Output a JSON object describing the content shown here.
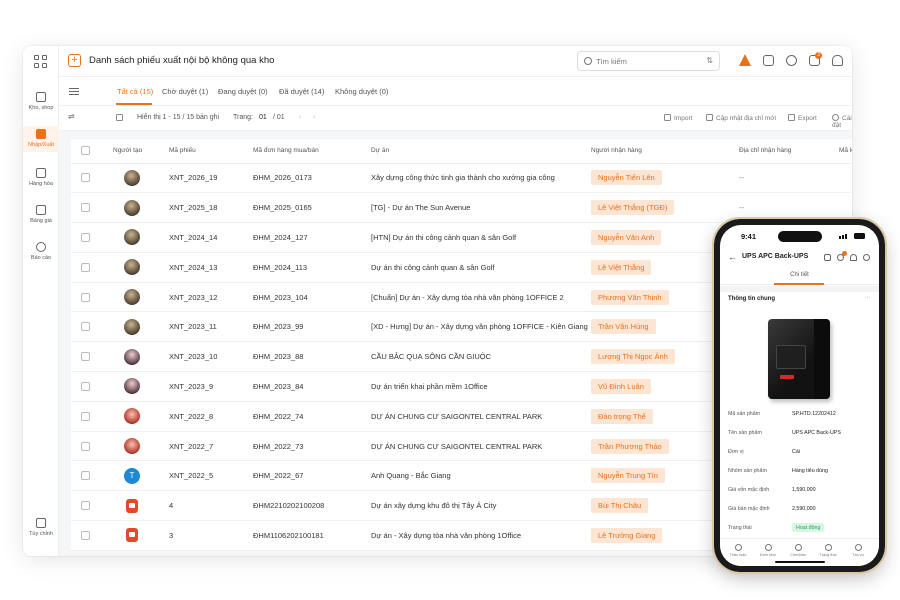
{
  "sidebar": {
    "items": [
      {
        "label": "Kho, shop"
      },
      {
        "label": "Nhập/Xuất"
      },
      {
        "label": "Hàng hóa"
      },
      {
        "label": "Bảng giá"
      },
      {
        "label": "Báo cáo"
      }
    ],
    "bottom": {
      "label": "Tùy chỉnh"
    }
  },
  "header": {
    "title": "Danh sách phiếu xuất nội bộ không qua kho",
    "search_placeholder": "Tìm kiếm",
    "notification_count": "3"
  },
  "tabs": [
    {
      "label": "Tất cả (15)"
    },
    {
      "label": "Chờ duyệt (1)"
    },
    {
      "label": "Đang duyệt (0)"
    },
    {
      "label": "Đã duyệt (14)"
    },
    {
      "label": "Không duyệt (0)"
    }
  ],
  "toolbar": {
    "summary": "Hiển thị 1 - 15 / 15 bản ghi",
    "page_label": "Trang:",
    "page_current": "01",
    "page_total": "/ 01",
    "import": "Import",
    "update_address": "Cập nhật địa chỉ mới",
    "export": "Export",
    "settings": "Cài đặt"
  },
  "table": {
    "columns": [
      "Người tạo",
      "Mã phiếu",
      "Mã đơn hàng mua/bán",
      "Dự án",
      "Người nhận hàng",
      "Địa chỉ nhận hàng",
      "Mã k"
    ],
    "rows": [
      {
        "avatar": "photo",
        "code": "XNT_2026_19",
        "order": "ĐHM_2026_0173",
        "project": "Xây dựng công thức tinh gia thành cho xưởng gia công",
        "receiver": "Nguyễn Tiến Lên",
        "address": "--"
      },
      {
        "avatar": "photo",
        "code": "XNT_2025_18",
        "order": "ĐHM_2025_0165",
        "project": "[TG] - Dự án The Sun Avenue",
        "receiver": "Lê Việt Thắng (TGĐ)",
        "address": "--"
      },
      {
        "avatar": "photo",
        "code": "XNT_2024_14",
        "order": "ĐHM_2024_127",
        "project": "[HTN] Dự án thi công cảnh quan & sân Golf",
        "receiver": "Nguyễn Văn Anh",
        "address": ""
      },
      {
        "avatar": "photo",
        "code": "XNT_2024_13",
        "order": "ĐHM_2024_113",
        "project": "Dự án thi công cảnh quan & sân Golf",
        "receiver": "Lê Việt Thắng",
        "address": ""
      },
      {
        "avatar": "photo",
        "code": "XNT_2023_12",
        "order": "ĐHM_2023_104",
        "project": "[Chuẩn] Dự án - Xây dựng tòa nhà văn phòng 1OFFICE 2",
        "receiver": "Phương Văn Thịnh",
        "address": ""
      },
      {
        "avatar": "photo",
        "code": "XNT_2023_11",
        "order": "ĐHM_2023_99",
        "project": "[XD - Hưng] Dự án - Xây dựng văn phòng 1OFFICE - Kiên Giang",
        "receiver": "Trần Văn Hùng",
        "address": ""
      },
      {
        "avatar": "woman",
        "code": "XNT_2023_10",
        "order": "ĐHM_2023_88",
        "project": "CẦU BẮC QUA SÔNG CẦN GIUỘC",
        "receiver": "Lương Thị Ngọc Ánh",
        "address": ""
      },
      {
        "avatar": "woman",
        "code": "XNT_2023_9",
        "order": "ĐHM_2023_84",
        "project": "Dự án triển khai phần mềm 1Office",
        "receiver": "Vũ Đình Luân",
        "address": ""
      },
      {
        "avatar": "red",
        "code": "XNT_2022_8",
        "order": "ĐHM_2022_74",
        "project": "DỰ ÁN CHUNG CƯ SAIGONTEL CENTRAL PARK",
        "receiver": "Đào trọng Thế",
        "address": ""
      },
      {
        "avatar": "red",
        "code": "XNT_2022_7",
        "order": "ĐHM_2022_73",
        "project": "DỰ ÁN CHUNG CƯ SAIGONTEL CENTRAL PARK",
        "receiver": "Trần Phương Thảo",
        "address": ""
      },
      {
        "avatar": "letter",
        "avatar_letter": "T",
        "code": "XNT_2022_5",
        "order": "ĐHM_2022_67",
        "project": "Anh Quang - Bắc Giang",
        "receiver": "Nguyễn Trung Tín",
        "address": ""
      },
      {
        "avatar": "file",
        "code": "4",
        "order": "ĐHM2210202100208",
        "project": "Dự án xây dựng khu đô thị Tây Á City",
        "receiver": "Bùi Thị Châu",
        "address": ""
      },
      {
        "avatar": "file",
        "code": "3",
        "order": "ĐHM1106202100181",
        "project": "Dự án - Xây dựng tòa nhà văn phòng 1Office",
        "receiver": "Lê Trường Giang",
        "address": ""
      }
    ]
  },
  "phone": {
    "time": "9:41",
    "title": "UPS APC Back-UPS",
    "tab": "Chi tiết",
    "section": "Thông tin chung",
    "fields": [
      {
        "label": "Mã sản phẩm",
        "value": "SP.HTD.12202412"
      },
      {
        "label": "Tên sản phẩm",
        "value": "UPS APC Back-UPS"
      },
      {
        "label": "Đơn vị",
        "value": "Cái"
      },
      {
        "label": "Nhóm sản phẩm",
        "value": "Hàng tiêu dùng"
      },
      {
        "label": "Giá vốn mặc định",
        "value": "1,590,000"
      },
      {
        "label": "Giá bán mặc định",
        "value": "2,590,000"
      },
      {
        "label": "Trạng thái",
        "value": "Hoạt động"
      }
    ],
    "bottom_nav": [
      "Thảo luận",
      "Đính kèm",
      "Checklist",
      "Trạng thái",
      "Tác vụ"
    ]
  },
  "colors": {
    "accent": "#e8711c",
    "chip_bg": "#fde5d4",
    "status_green": "#21a15a"
  }
}
